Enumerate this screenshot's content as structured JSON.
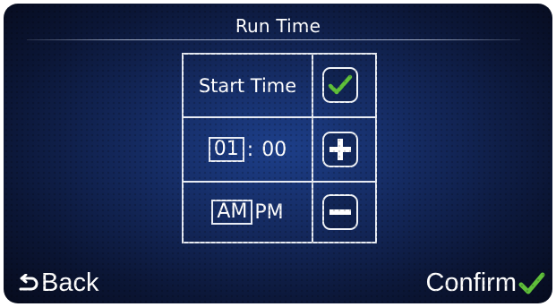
{
  "header": {
    "title": "Run Time"
  },
  "run_time": {
    "label": "Start Time",
    "hour": "01",
    "separator": ":",
    "minute": "00",
    "am": "AM",
    "pm": "PM",
    "selected_field": "hour",
    "selected_period": "AM"
  },
  "footer": {
    "back_label": "Back",
    "confirm_label": "Confirm"
  },
  "colors": {
    "accent_check": "#5fbf3a",
    "line": "#e8ecf4"
  },
  "icons": [
    "back-arrow-icon",
    "checkmark-icon",
    "plus-icon",
    "minus-icon"
  ]
}
